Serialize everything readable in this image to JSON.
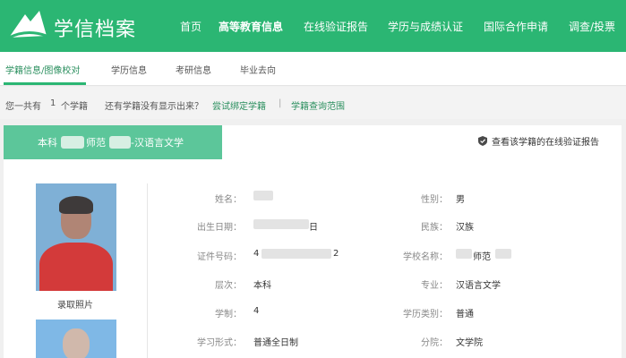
{
  "header": {
    "brand": "学信档案",
    "nav": [
      {
        "label": "首页",
        "active": false
      },
      {
        "label": "高等教育信息",
        "active": true
      },
      {
        "label": "在线验证报告",
        "active": false
      },
      {
        "label": "学历与成绩认证",
        "active": false
      },
      {
        "label": "国际合作申请",
        "active": false
      },
      {
        "label": "调查/投票",
        "active": false
      }
    ]
  },
  "subnav": {
    "items": [
      {
        "label": "学籍信息/图像校对",
        "active": true
      },
      {
        "label": "学历信息",
        "active": false
      },
      {
        "label": "考研信息",
        "active": false
      },
      {
        "label": "毕业去向",
        "active": false
      }
    ]
  },
  "count": {
    "prefix": "您一共有",
    "number": "1",
    "suffix": "个学籍",
    "question": "还有学籍没有显示出来？",
    "bind_link": "尝试绑定学籍",
    "separator": "|",
    "scope_link": "学籍查询范围"
  },
  "card": {
    "tab_prefix": "本科",
    "tab_middle": "师范",
    "tab_suffix": "-汉语言文学",
    "verify_link": "查看该学籍的在线验证报告",
    "photo_caption": "录取照片",
    "left_fields": [
      {
        "label": "姓名：",
        "value": ""
      },
      {
        "label": "出生日期：",
        "value": "日"
      },
      {
        "label": "证件号码：",
        "value": "4",
        "value_end": "2"
      },
      {
        "label": "层次：",
        "value": "本科"
      },
      {
        "label": "学制：",
        "value": "4"
      },
      {
        "label": "学习形式：",
        "value": "普通全日制"
      }
    ],
    "right_fields": [
      {
        "label": "性别：",
        "value": "男"
      },
      {
        "label": "民族：",
        "value": "汉族"
      },
      {
        "label": "学校名称：",
        "value": "师范"
      },
      {
        "label": "专业：",
        "value": "汉语言文学"
      },
      {
        "label": "学历类别：",
        "value": "普通"
      },
      {
        "label": "分院：",
        "value": "文学院"
      }
    ]
  },
  "colors": {
    "brand_green": "#2bb673",
    "tab_green": "#5cc69a",
    "link_green": "#2a8f5e"
  },
  "icons": {
    "logo": "book-logo-icon",
    "verify": "shield-check-icon"
  }
}
